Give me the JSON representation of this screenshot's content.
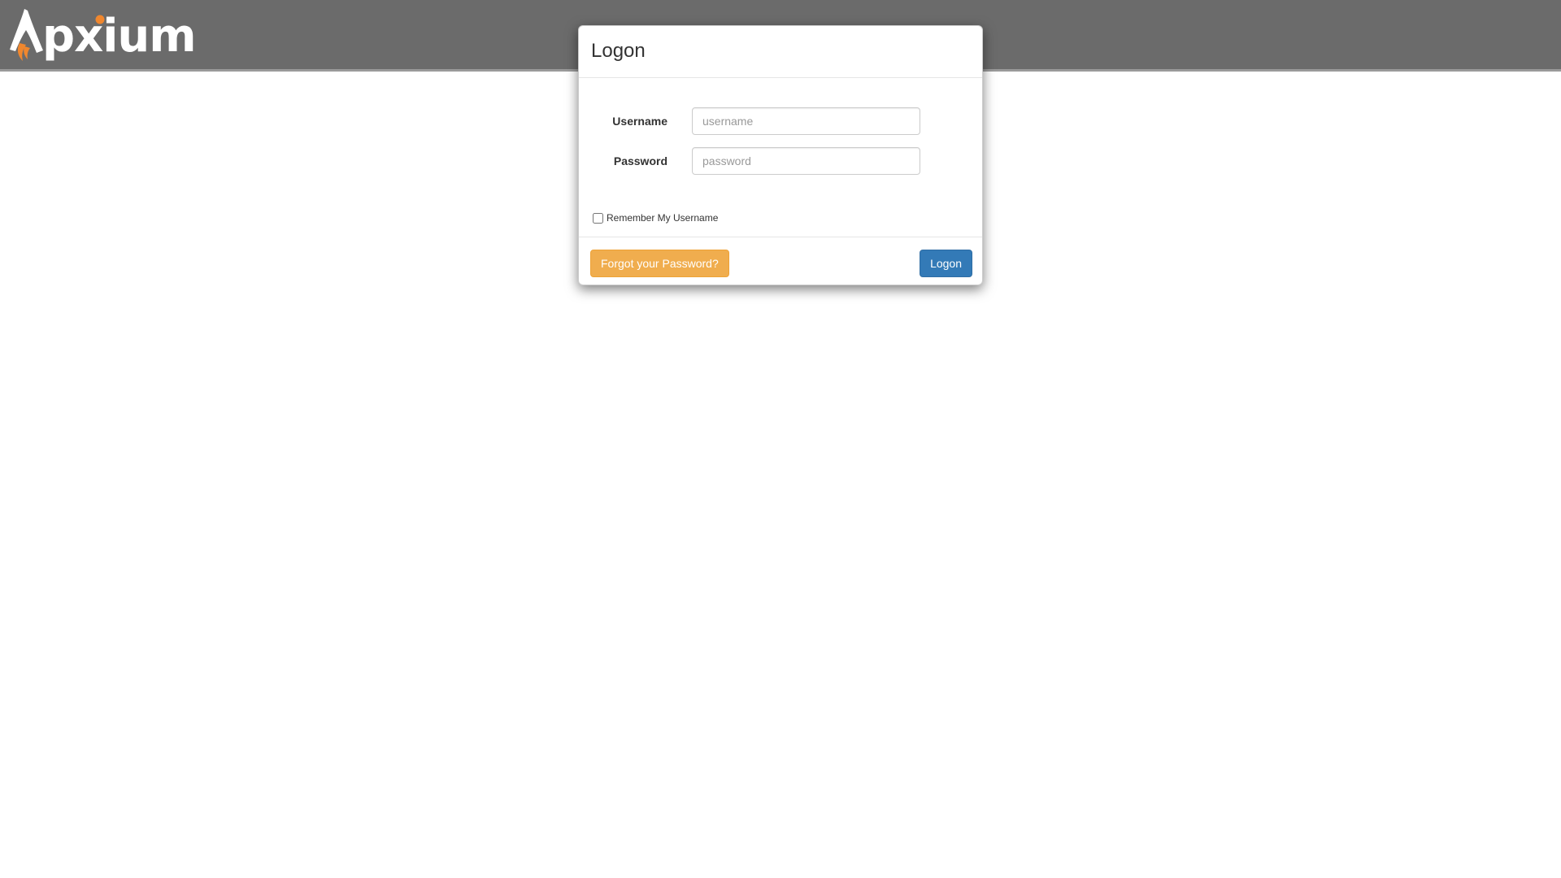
{
  "header": {
    "logo_text": "pxium",
    "logo_icon": "rocket-a-icon",
    "background_color": "#6b6b6b",
    "accent_color": "#f0872e"
  },
  "modal": {
    "title": "Logon",
    "username": {
      "label": "Username",
      "value": "",
      "placeholder": "username"
    },
    "password": {
      "label": "Password",
      "value": "",
      "placeholder": "password"
    },
    "remember": {
      "label": "Remember My Username",
      "checked": false
    },
    "forgot_label": "Forgot your Password?",
    "logon_label": "Logon",
    "colors": {
      "forgot_button": "#f0ad4e",
      "logon_button": "#337ab7"
    }
  }
}
